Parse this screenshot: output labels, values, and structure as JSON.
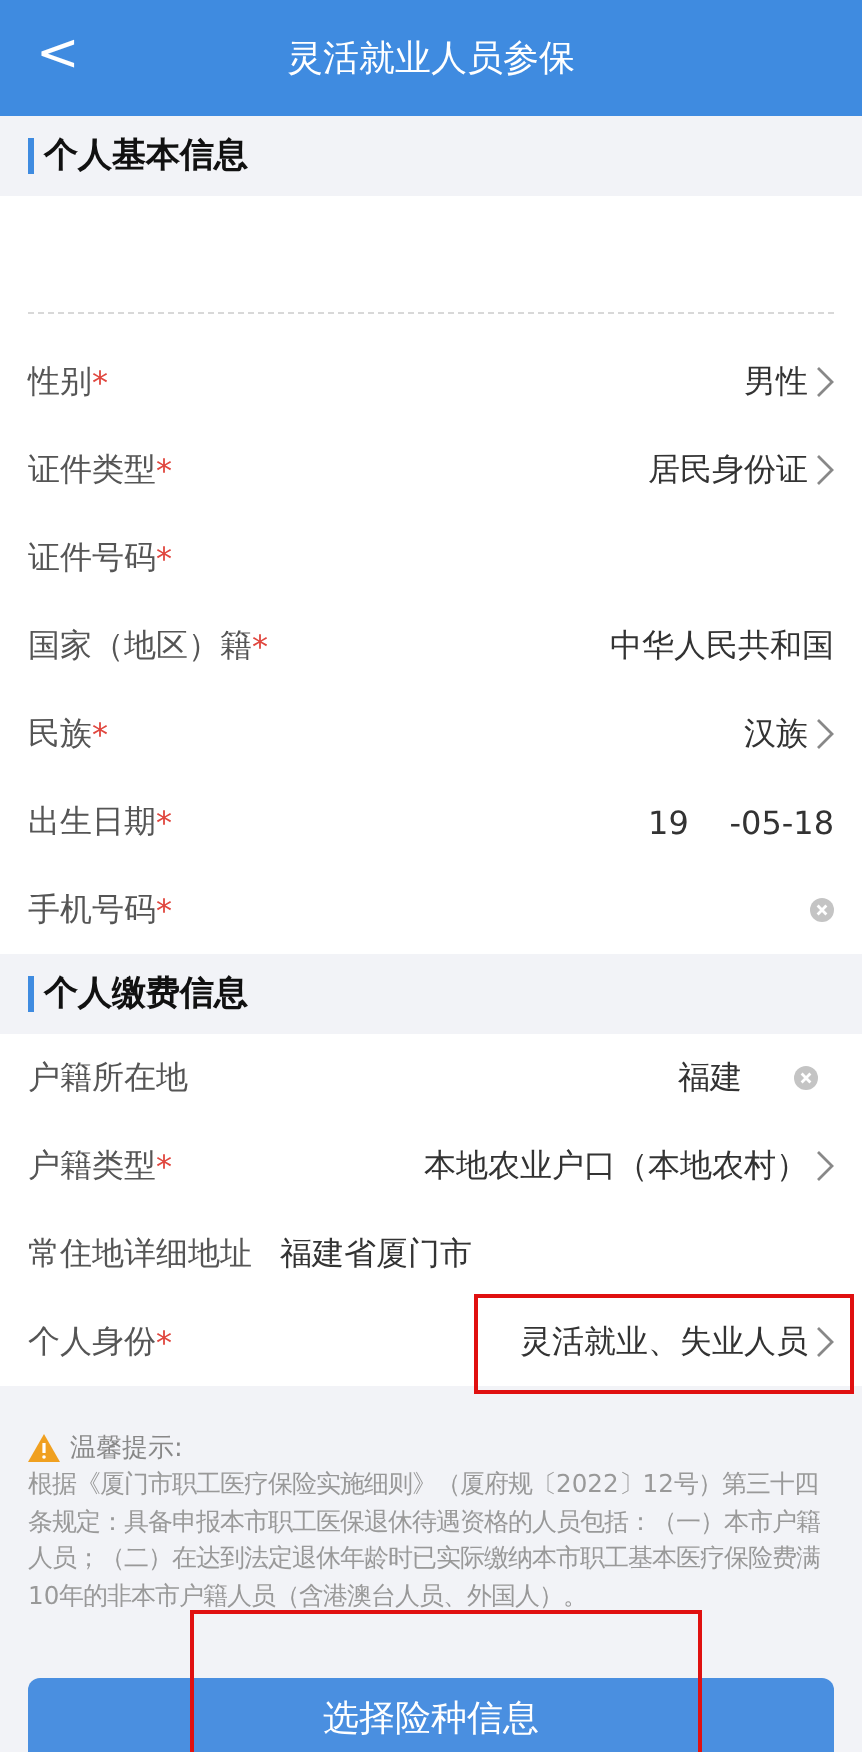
{
  "header": {
    "back": "<",
    "title": "灵活就业人员参保"
  },
  "sections": [
    {
      "title": "个人基本信息",
      "blank_top": true,
      "rows": [
        {
          "label": "性别",
          "required": "*",
          "kind": "select",
          "value": "男性",
          "highlighted": false
        },
        {
          "label": "证件类型",
          "required": "*",
          "kind": "select",
          "value": "居民身份证",
          "highlighted": false
        },
        {
          "label": "证件号码",
          "required": "*",
          "kind": "text",
          "highlighted": false
        },
        {
          "label": "国家（地区）籍",
          "required": "*",
          "kind": "text",
          "value": "中华人民共和国",
          "highlighted": false
        },
        {
          "label": "民族",
          "required": "*",
          "kind": "select",
          "value": "汉族",
          "highlighted": false
        },
        {
          "label": "出生日期",
          "required": "*",
          "kind": "text",
          "value": "19    -05-18",
          "highlighted": false
        },
        {
          "label": "手机号码",
          "required": "*",
          "kind": "clearable",
          "highlighted": false
        }
      ]
    },
    {
      "title": "个人缴费信息",
      "blank_top": false,
      "rows": [
        {
          "label": "户籍所在地",
          "kind": "clearable",
          "value": "福建",
          "highlighted": false
        },
        {
          "label": "户籍类型",
          "required": "*",
          "kind": "select",
          "value": "本地农业户口（本地农村）",
          "highlighted": false
        },
        {
          "label": "常住地详细地址",
          "kind": "inline",
          "value": "福建省厦门市",
          "highlighted": false
        },
        {
          "label": "个人身份",
          "required": "*",
          "kind": "select",
          "value": "灵活就业、失业人员",
          "highlighted": true
        }
      ]
    }
  ],
  "notice": {
    "title": "温馨提示:",
    "text": "根据《厦门市职工医疗保险实施细则》（厦府规〔2022〕12号）第三十四条规定：具备申报本市职工医保退休待遇资格的人员包括：（一）本市户籍人员；（二）在达到法定退休年龄时已实际缴纳本市职工基本医疗保险费满10年的非本市户籍人员（含港澳台人员、外国人）。"
  },
  "button": {
    "label": "选择险种信息",
    "highlighted": true
  }
}
